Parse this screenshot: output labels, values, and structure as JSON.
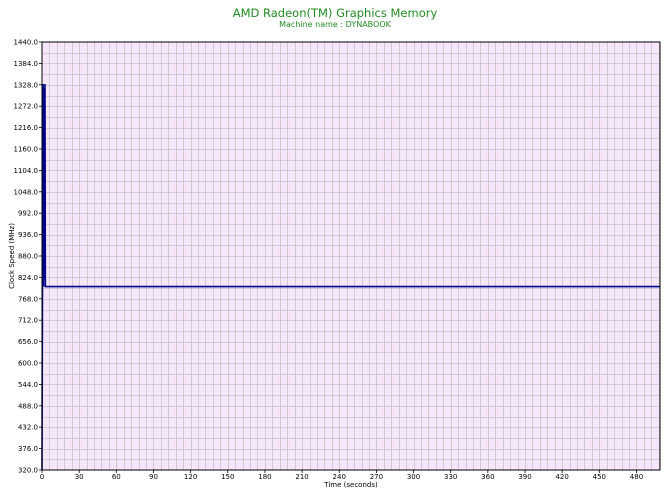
{
  "chart_data": {
    "type": "line",
    "title": "AMD Radeon(TM) Graphics Memory",
    "subtitle": "Machine name : DYNABOOK",
    "xlabel": "Time (seconds)",
    "ylabel": "Clock Speed (MHz)",
    "xlim": [
      0,
      499
    ],
    "ylim": [
      320,
      1440
    ],
    "x_ticks": [
      0,
      30,
      60,
      90,
      120,
      150,
      180,
      210,
      240,
      270,
      300,
      330,
      360,
      390,
      420,
      450,
      480
    ],
    "y_ticks": [
      "320.0",
      "376.0",
      "432.0",
      "488.0",
      "544.0",
      "600.0",
      "656.0",
      "712.0",
      "768.0",
      "824.0",
      "880.0",
      "936.0",
      "992.0",
      "1048.0",
      "1104.0",
      "1160.0",
      "1216.0",
      "1272.0",
      "1328.0",
      "1384.0",
      "1440.0"
    ],
    "grid": true,
    "series": [
      {
        "color": "#00008b",
        "x": [
          0,
          0.3,
          0.6,
          0.9,
          1.2,
          1.5,
          1.8,
          2.1,
          2.4,
          2.7,
          3.0,
          499
        ],
        "y": [
          320,
          700,
          1200,
          1330,
          800,
          1320,
          1150,
          820,
          1330,
          800,
          800,
          800
        ]
      }
    ]
  },
  "colors": {
    "title": "#228b22",
    "plot_background": "#f5e6fb",
    "grid": "#b4b4b4",
    "series": "#00008b"
  }
}
